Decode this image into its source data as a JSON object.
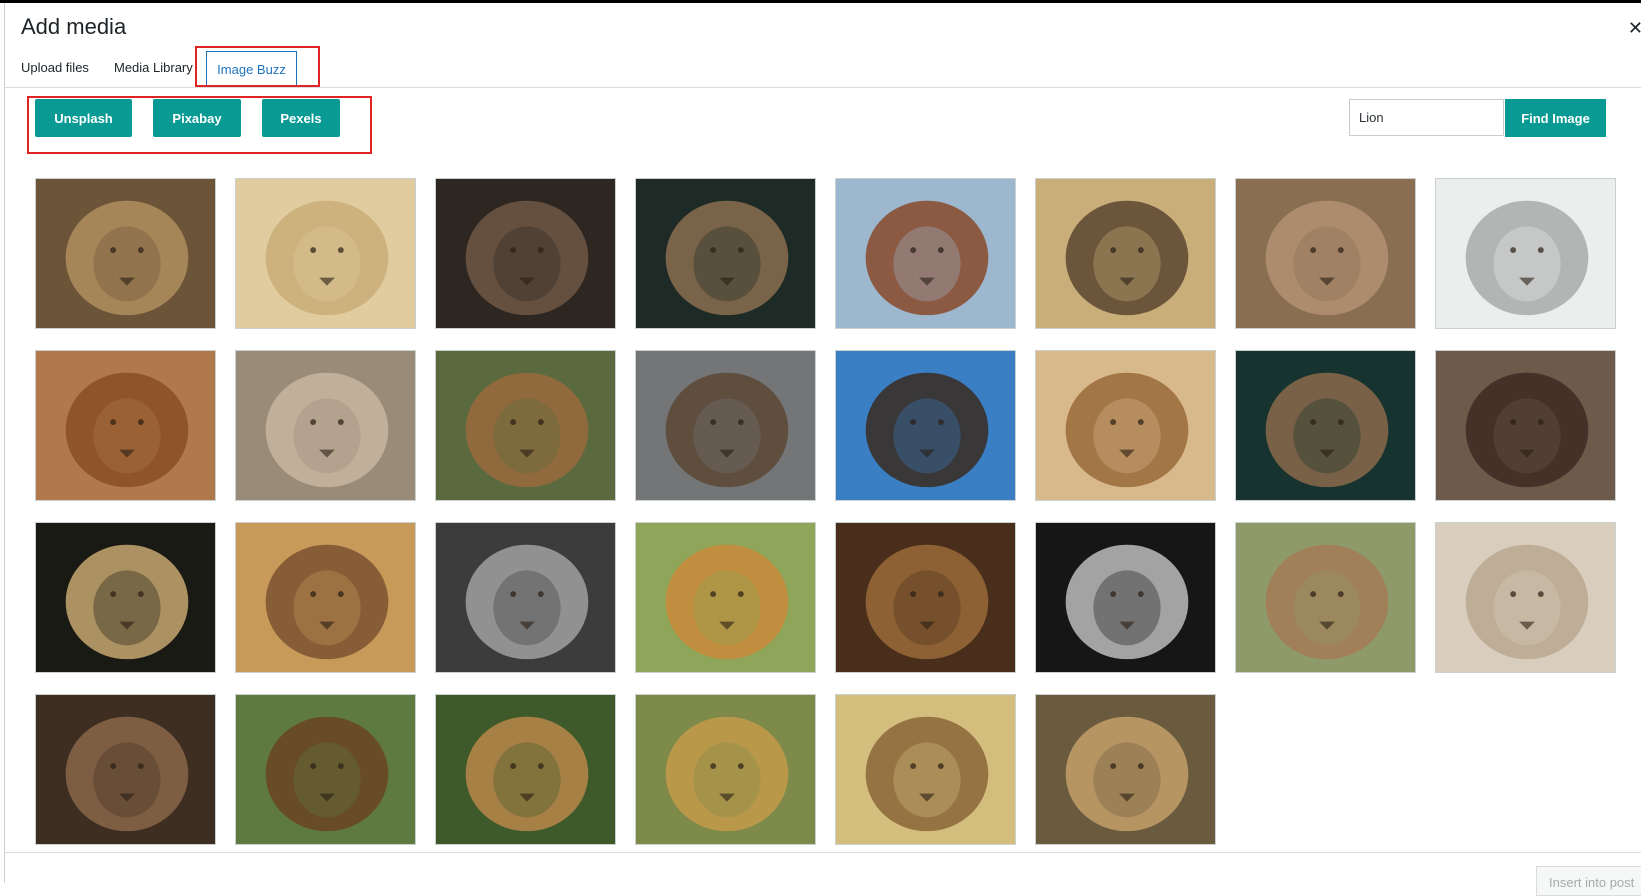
{
  "title": "Add media",
  "close_icon": "close-icon",
  "tabs": [
    {
      "label": "Upload files",
      "active": false
    },
    {
      "label": "Media Library",
      "active": false
    },
    {
      "label": "Image Buzz",
      "active": true
    }
  ],
  "sources": [
    "Unsplash",
    "Pixabay",
    "Pexels"
  ],
  "search": {
    "value": "Lion",
    "button": "Find Image"
  },
  "footer": {
    "insert_button": "Insert into post"
  },
  "colors": {
    "accent": "#0a9a94",
    "highlight": "#e02323",
    "tab_border": "#1e73be"
  },
  "results": [
    {
      "bg": "#6b5438",
      "fg": "#b08e5e"
    },
    {
      "bg": "#e0cc9e",
      "fg": "#c9ad78"
    },
    {
      "bg": "#2e2620",
      "fg": "#6e5846"
    },
    {
      "bg": "#1d2a26",
      "fg": "#8a6f50"
    },
    {
      "bg": "#9db7cf",
      "fg": "#8a4a2a"
    },
    {
      "bg": "#c9ae7a",
      "fg": "#5a4630"
    },
    {
      "bg": "#8a6e52",
      "fg": "#b39273"
    },
    {
      "bg": "#eceeee",
      "fg": "#a9a9a9"
    },
    {
      "bg": "#b0794c",
      "fg": "#8a4f22"
    },
    {
      "bg": "#9a8a78",
      "fg": "#c7b6a0"
    },
    {
      "bg": "#5b6a3e",
      "fg": "#9a6a3c"
    },
    {
      "bg": "#737577",
      "fg": "#5c4632"
    },
    {
      "bg": "#3a7fc4",
      "fg": "#3a2a1e"
    },
    {
      "bg": "#d8b98c",
      "fg": "#9a6a3a"
    },
    {
      "bg": "#17332f",
      "fg": "#8a6a4a"
    },
    {
      "bg": "#6e5a4a",
      "fg": "#3d2c22"
    },
    {
      "bg": "#1a1a14",
      "fg": "#c7a870"
    },
    {
      "bg": "#c79a5a",
      "fg": "#7a5230"
    },
    {
      "bg": "#3c3c3c",
      "fg": "#a0a0a0"
    },
    {
      "bg": "#8fa65a",
      "fg": "#c98a3a"
    },
    {
      "bg": "#4a2e1c",
      "fg": "#9a6a3a"
    },
    {
      "bg": "#161616",
      "fg": "#bcbcbc"
    },
    {
      "bg": "#8f9a6a",
      "fg": "#a47a55"
    },
    {
      "bg": "#d9cdbd",
      "fg": "#b8a791"
    },
    {
      "bg": "#3e2e22",
      "fg": "#8a6648"
    },
    {
      "bg": "#5e7a3e",
      "fg": "#6a4424"
    },
    {
      "bg": "#3e5a2a",
      "fg": "#b8874a"
    },
    {
      "bg": "#7e8a4a",
      "fg": "#c49a4a"
    },
    {
      "bg": "#d4be7e",
      "fg": "#8a6638"
    },
    {
      "bg": "#6a5a3e",
      "fg": "#c4a06a"
    }
  ]
}
